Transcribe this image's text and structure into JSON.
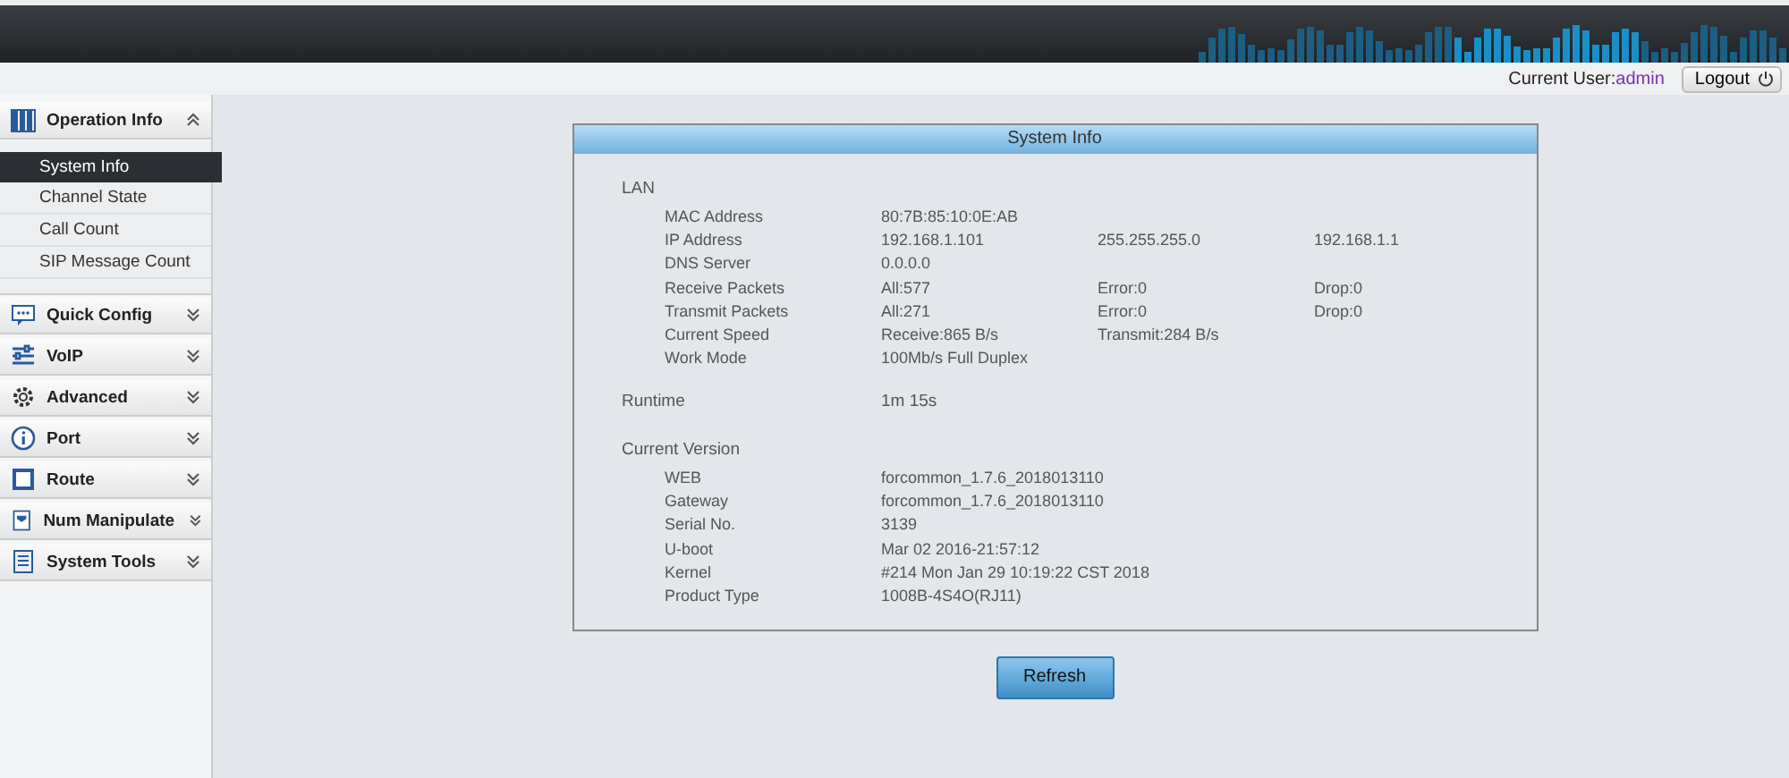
{
  "header": {
    "user_label": "Current User:",
    "user_name": "admin",
    "logout": "Logout"
  },
  "sidebar": {
    "groups": [
      {
        "label": "Operation Info",
        "expanded": true,
        "children": [
          {
            "label": "System Info",
            "selected": true
          },
          {
            "label": "Channel State",
            "selected": false
          },
          {
            "label": "Call Count",
            "selected": false
          },
          {
            "label": "SIP Message Count",
            "selected": false
          }
        ]
      },
      {
        "label": "Quick Config",
        "expanded": false
      },
      {
        "label": "VoIP",
        "expanded": false
      },
      {
        "label": "Advanced",
        "expanded": false
      },
      {
        "label": "Port",
        "expanded": false
      },
      {
        "label": "Route",
        "expanded": false
      },
      {
        "label": "Num Manipulate",
        "expanded": false
      },
      {
        "label": "System Tools",
        "expanded": false
      }
    ]
  },
  "panel": {
    "title": "System Info",
    "sections": [
      {
        "title": "LAN",
        "rows": [
          {
            "label": "MAC Address",
            "values": [
              "80:7B:85:10:0E:AB"
            ]
          },
          {
            "label": "IP Address",
            "values": [
              "192.168.1.101",
              "255.255.255.0",
              "192.168.1.1"
            ]
          },
          {
            "label": "DNS Server",
            "values": [
              "0.0.0.0"
            ]
          },
          {
            "label": "Receive Packets",
            "values": [
              "All:577",
              "Error:0",
              "Drop:0"
            ]
          },
          {
            "label": "Transmit Packets",
            "values": [
              "All:271",
              "Error:0",
              "Drop:0"
            ]
          },
          {
            "label": "Current Speed",
            "values": [
              "Receive:865 B/s",
              "Transmit:284 B/s"
            ]
          },
          {
            "label": "Work Mode",
            "values": [
              "100Mb/s Full Duplex"
            ]
          }
        ]
      },
      {
        "title": "Runtime",
        "value": "1m 15s"
      },
      {
        "title": "Current Version",
        "rows": [
          {
            "label": "WEB",
            "values": [
              "forcommon_1.7.6_2018013110"
            ]
          },
          {
            "label": "Gateway",
            "values": [
              "forcommon_1.7.6_2018013110"
            ]
          },
          {
            "label": "Serial No.",
            "values": [
              "3139"
            ]
          },
          {
            "label": "U-boot",
            "values": [
              "Mar 02 2016-21:57:12"
            ]
          },
          {
            "label": "Kernel",
            "values": [
              "#214 Mon Jan 29 10:19:22 CST 2018"
            ]
          },
          {
            "label": "Product Type",
            "values": [
              "1008B-4S4O(RJ11)"
            ]
          }
        ]
      }
    ],
    "button": "Refresh"
  }
}
